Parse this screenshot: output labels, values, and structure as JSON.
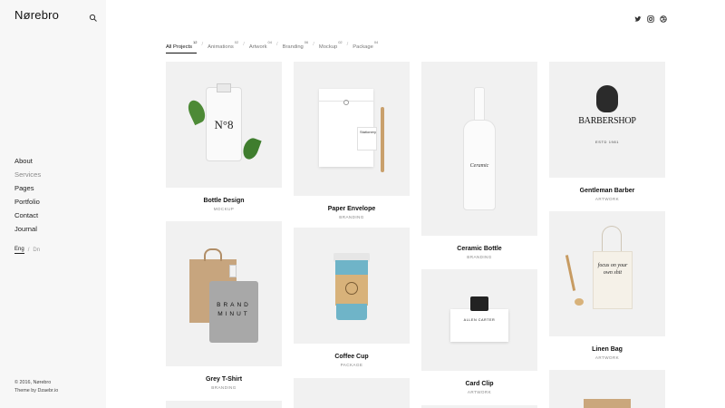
{
  "brand": {
    "logo": "Nørebro"
  },
  "sidebar": {
    "nav": [
      {
        "label": "About"
      },
      {
        "label": "Services"
      },
      {
        "label": "Pages"
      },
      {
        "label": "Portfolio"
      },
      {
        "label": "Contact"
      },
      {
        "label": "Journal"
      }
    ],
    "languages": {
      "active": "Eng",
      "separator": "/",
      "other": "Dn"
    },
    "footer": {
      "copyright": "© 2016, Nørebro",
      "credit": "Theme by Dzaebr.io"
    }
  },
  "header": {
    "social_icons": [
      "twitter-icon",
      "instagram-icon",
      "dribbble-icon"
    ]
  },
  "filters": [
    {
      "label": "All Projects",
      "count": "12"
    },
    {
      "label": "Animations",
      "count": "02"
    },
    {
      "label": "Artwork",
      "count": "04"
    },
    {
      "label": "Branding",
      "count": "06"
    },
    {
      "label": "Mockup",
      "count": "02"
    },
    {
      "label": "Package",
      "count": "04"
    }
  ],
  "filter_separator": "/",
  "projects": [
    {
      "title": "Bottle Design",
      "category": "MOCKUP",
      "mock_text": "N°8"
    },
    {
      "title": "Paper  Envelope",
      "category": "BRANDING",
      "mock_text": "Stationery"
    },
    {
      "title": "Ceramic Bottle",
      "category": "BRANDING",
      "mock_text": "Ceramic"
    },
    {
      "title": "Gentleman Barber",
      "category": "ARTWORK",
      "mock_text": "BARBERSHOP",
      "mock_sub": "ESTD 1981"
    },
    {
      "title": "Grey T-Shirt",
      "category": "BRANDING",
      "mock_text": "BRAND MINUT"
    },
    {
      "title": "Coffee Cup",
      "category": "PACKAGE"
    },
    {
      "title": "Card Clip",
      "category": "ARTWORK",
      "mock_text": "ALLEN CARTER"
    },
    {
      "title": "Linen Bag",
      "category": "ARTWORK",
      "mock_text": "focus on your own shit"
    }
  ],
  "colors": {
    "sidebar_bg": "#f7f7f7",
    "thumb_bg": "#f1f1f1",
    "text": "#222222",
    "muted": "#888888"
  }
}
